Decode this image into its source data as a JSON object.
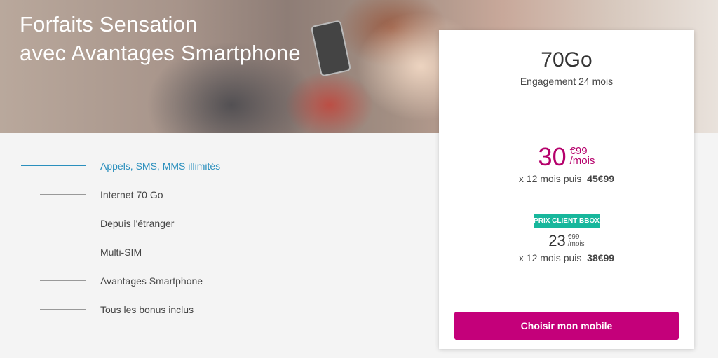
{
  "hero": {
    "title_line1": "Forfaits Sensation",
    "title_line2": "avec Avantages Smartphone"
  },
  "features": [
    {
      "label": "Appels, SMS, MMS illimités",
      "active": true
    },
    {
      "label": "Internet 70 Go",
      "active": false
    },
    {
      "label": "Depuis l'étranger",
      "active": false
    },
    {
      "label": "Multi-SIM",
      "active": false
    },
    {
      "label": "Avantages Smartphone",
      "active": false
    },
    {
      "label": "Tous les bonus inclus",
      "active": false
    }
  ],
  "offer": {
    "plan_name": "70Go",
    "engagement": "Engagement 24 mois",
    "price": {
      "integer": "30",
      "cents": "€99",
      "period": "/mois",
      "duration_prefix": "x 12 mois puis",
      "after_price": "45€99"
    },
    "client_badge": "PRIX CLIENT BBOX",
    "client_price": {
      "integer": "23",
      "cents": "€99",
      "period": "/mois",
      "duration_prefix": "x 12 mois puis",
      "after_price": "38€99"
    },
    "cta_label": "Choisir mon mobile"
  },
  "colors": {
    "accent": "#c4007a",
    "price": "#b5006b",
    "active_link": "#2a8fbd",
    "badge": "#17b79c"
  }
}
